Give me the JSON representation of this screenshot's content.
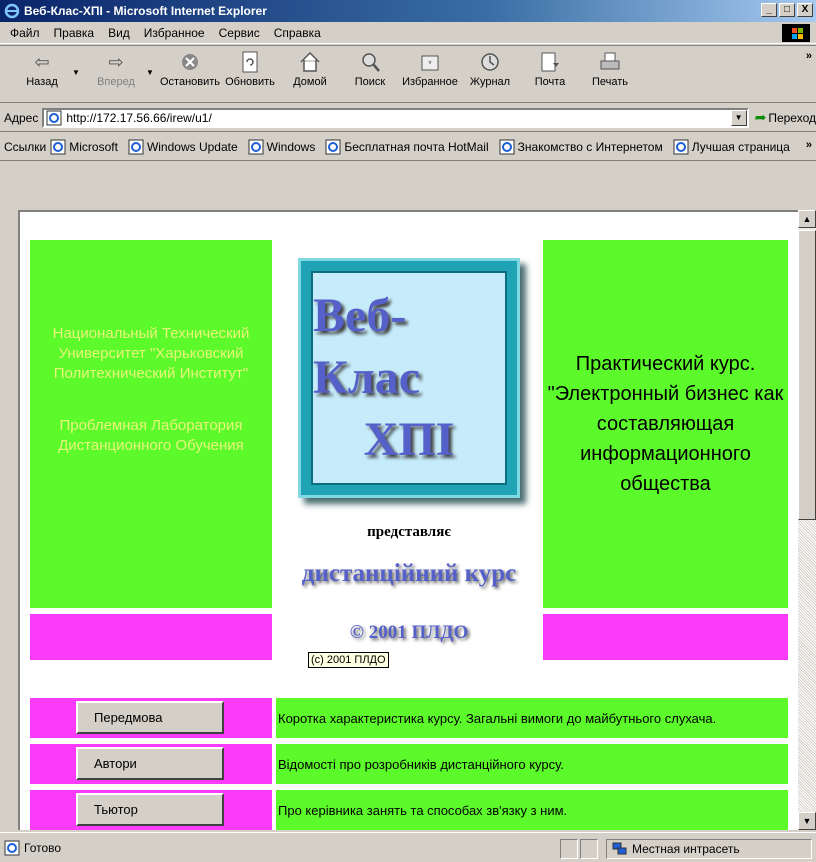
{
  "window": {
    "title": "Веб-Клас-ХПІ - Microsoft Internet Explorer",
    "buttons": {
      "minimize": "_",
      "maximize": "□",
      "close": "X"
    }
  },
  "menu": [
    "Файл",
    "Правка",
    "Вид",
    "Избранное",
    "Сервис",
    "Справка"
  ],
  "toolbar": {
    "back": "Назад",
    "forward": "Вперед",
    "stop": "Остановить",
    "refresh": "Обновить",
    "home": "Домой",
    "search": "Поиск",
    "favorites": "Избранное",
    "history": "Журнал",
    "mail": "Почта",
    "print": "Печать"
  },
  "address": {
    "label": "Адрес",
    "url": "http://172.17.56.66/irew/u1/",
    "go": "Переход"
  },
  "links": {
    "label": "Ссылки",
    "items": [
      "Microsoft",
      "Windows Update",
      "Windows",
      "Бесплатная почта HotMail",
      "Знакомство с Интернетом",
      "Лучшая страница"
    ]
  },
  "page": {
    "left_box_line1": "Национальный Технический Университет \"Харьковский Политехнический Институт\"",
    "left_box_line2": "Проблемная Лаборатория Дистанционного Обучения",
    "logo_line1": "Веб-Клас",
    "logo_line2": "ХПІ",
    "presents": "представляє",
    "course": "дистанційний курс",
    "copyright": "© 2001 ПЛДО",
    "tooltip": "(c) 2001 ПЛДО",
    "right_box": "Практический курс. \"Электронный бизнес как составляющая информационного общества",
    "rows": [
      {
        "button": "Передмова",
        "text": "Коротка характеристика курсу. Загальні вимоги до майбутнього слухача."
      },
      {
        "button": "Автори",
        "text": "Відомості про розробників дистанційного курсу."
      },
      {
        "button": "Тьютор",
        "text": "Про керівника занять та способах зв'язку з ним."
      }
    ]
  },
  "status": {
    "text": "Готово",
    "zone": "Местная интрасеть"
  },
  "colors": {
    "green": "#5dfa2b",
    "magenta": "#fa3cfa",
    "logo_text": "#5560c8"
  }
}
